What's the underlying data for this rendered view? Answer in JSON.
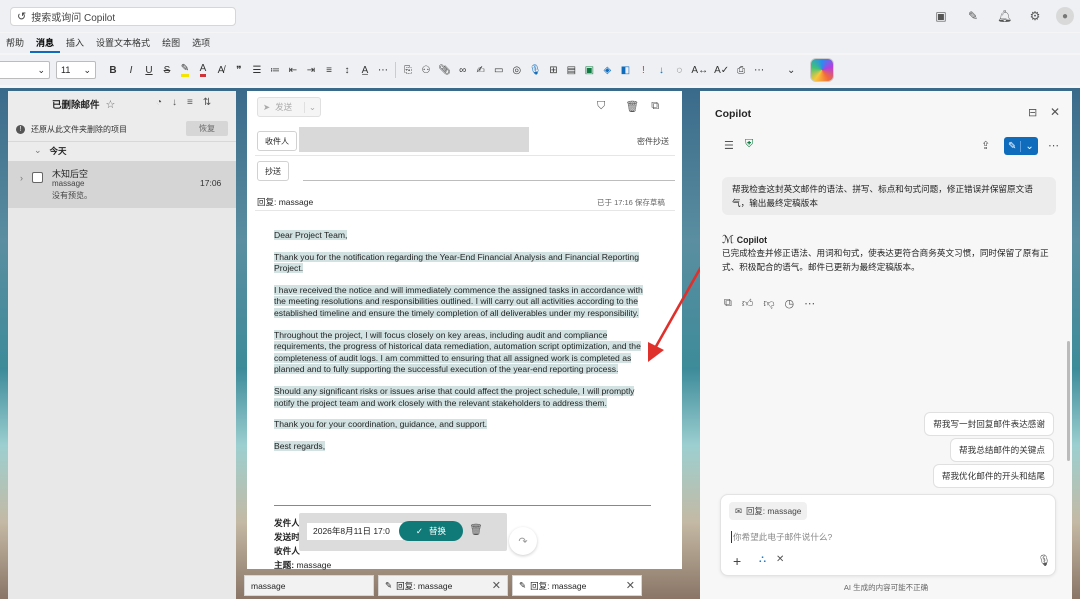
{
  "topbar": {
    "search_placeholder": "搜索或询问 Copilot"
  },
  "menu": [
    "帮助",
    "消息",
    "插入",
    "设置文本格式",
    "绘图",
    "选项"
  ],
  "menu_active": "消息",
  "toolbar": {
    "font_size": "11"
  },
  "folder": {
    "title": "已删除邮件",
    "restore_text": "还原从此文件夹删除的项目",
    "restore_button": "恢复",
    "group": "今天",
    "item": {
      "sender": "木知后空",
      "subject": "massage",
      "preview": "没有预览。",
      "time": "17:06"
    }
  },
  "compose": {
    "send": "发送",
    "to_label": "收件人",
    "bcc_link": "密件抄送",
    "cc_label": "抄送",
    "subject": "回复: massage",
    "draft_status": "已于 17:16 保存草稿",
    "greeting": "Dear Project Team,",
    "p1": "Thank you for the notification regarding the Year-End Financial Analysis and Financial Reporting Project.",
    "p2": "I have received the notice and will immediately commence the assigned tasks in accordance with the meeting resolutions and responsibilities outlined. I will carry out all activities according to the established timeline and ensure the timely completion of all deliverables under my responsibility.",
    "p3": "Throughout the project, I will focus closely on key areas, including audit and compliance requirements, the progress of historical data remediation, automation script optimization, and the completeness of audit logs. I am committed to ensuring that all assigned work is completed as planned and to fully supporting the successful execution of the year-end reporting process.",
    "p4": "Should any significant risks or issues arise that could affect the project schedule, I will promptly notify the project team and work closely with the relevant stakeholders to address them.",
    "p5": "Thank you for your coordination, guidance, and support.",
    "closing": "Best regards,",
    "quoted": {
      "from": "发件人",
      "sent": "发送时",
      "to": "收件人",
      "subject_label": "主题:",
      "subject_value": "massage"
    },
    "popup": {
      "date": "2026年8月11日 17:0",
      "replace": "替换"
    }
  },
  "bottom_tabs": [
    {
      "label": "massage"
    },
    {
      "label": "回复: massage"
    },
    {
      "label": "回复: massage"
    }
  ],
  "copilot": {
    "title": "Copilot",
    "user_msg": "帮我检查这封英文邮件的语法、拼写、标点和句式问题，修正错误并保留原文语气，输出最终定稿版本",
    "assistant_name": "Copilot",
    "assistant_msg": "已完成检查并修正语法、用词和句式，使表达更符合商务英文习惯，同时保留了原有正式、积极配合的语气。邮件已更新为最终定稿版本。",
    "suggestions": [
      "帮我写一封回复邮件表达感谢",
      "帮我总结邮件的关键点",
      "帮我优化邮件的开头和结尾"
    ],
    "context_chip": "回复: massage",
    "input_placeholder": "你希望此电子邮件说什么?",
    "disclaimer": "AI 生成的内容可能不正确"
  },
  "colors": {
    "accent": "#0f6cbd",
    "highlight": "#d2e2e2",
    "arrow": "#e0302b"
  }
}
